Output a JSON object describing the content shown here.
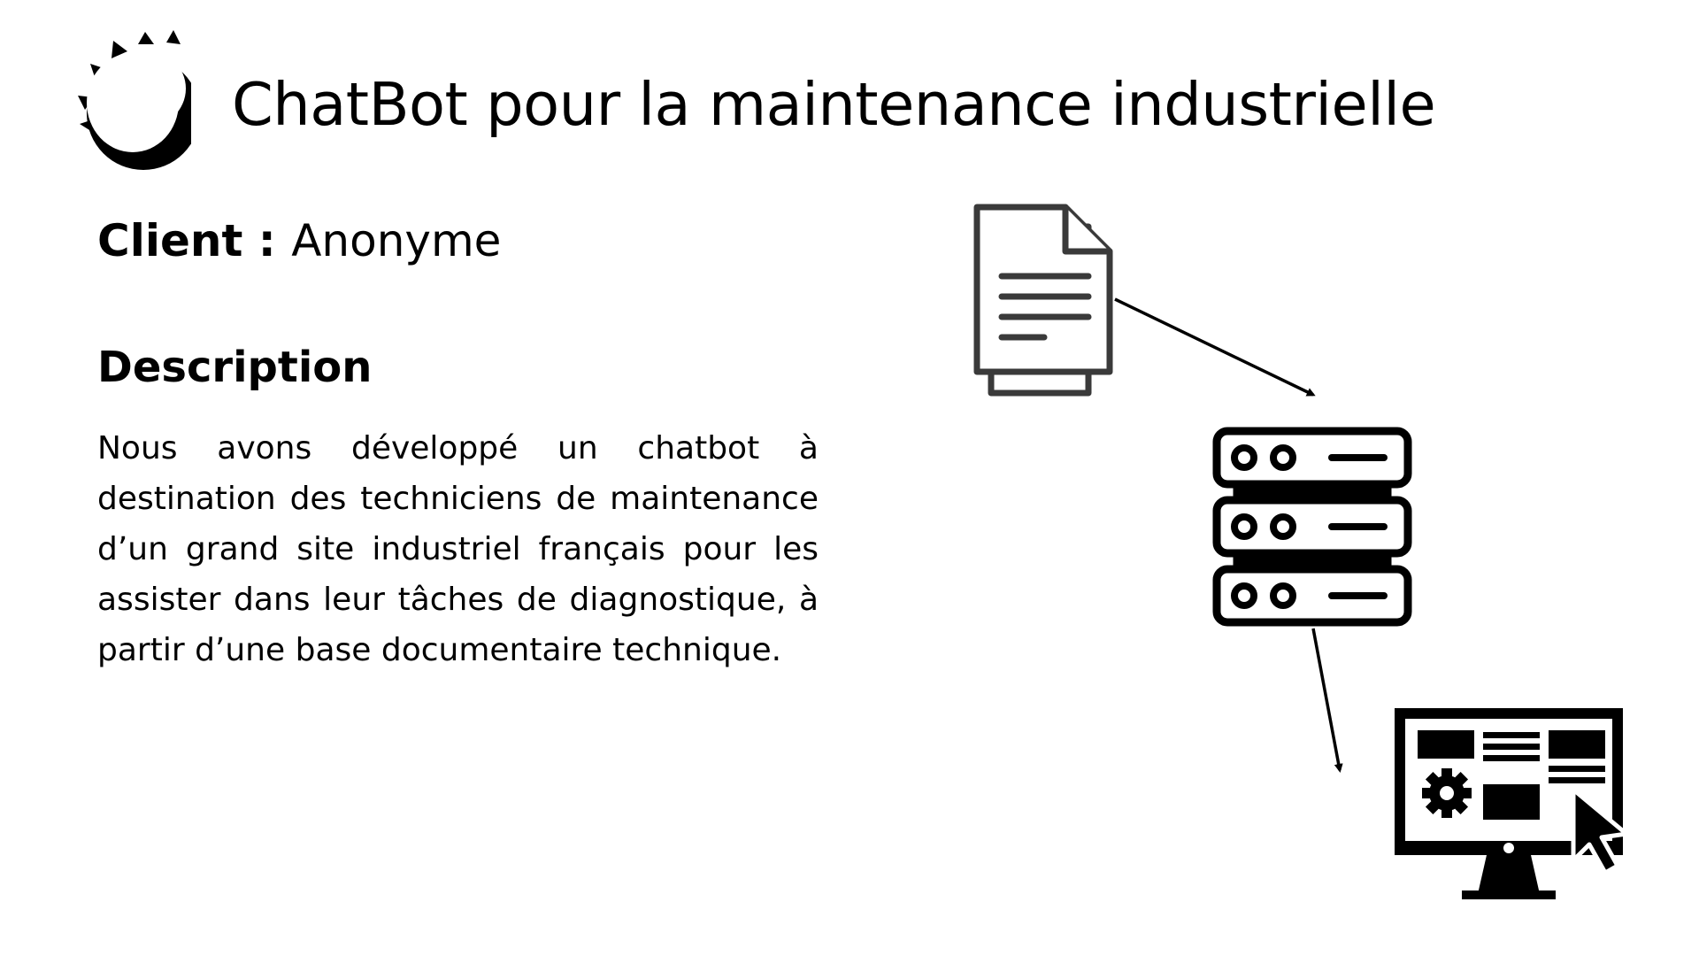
{
  "header": {
    "logo_icon": "sun-moon-logo-icon",
    "title": "ChatBot pour la maintenance industrielle"
  },
  "client": {
    "label": "Client",
    "separator": " : ",
    "value": "Anonyme"
  },
  "description": {
    "heading": "Description",
    "text": "Nous avons développé un chatbot à destination des techniciens de maintenance d’un grand site industriel français pour les assister dans leur tâches de diagnostique, à partir d’une base documentaire technique."
  },
  "diagram": {
    "nodes": [
      {
        "icon": "documents-icon"
      },
      {
        "icon": "server-icon"
      },
      {
        "icon": "computer-screen-icon"
      }
    ],
    "arrows": [
      {
        "from": "documents-icon",
        "to": "server-icon"
      },
      {
        "from": "server-icon",
        "to": "computer-screen-icon"
      }
    ],
    "colors": {
      "document_stroke": "#3a3a3a",
      "icon_fill": "#000000"
    }
  }
}
